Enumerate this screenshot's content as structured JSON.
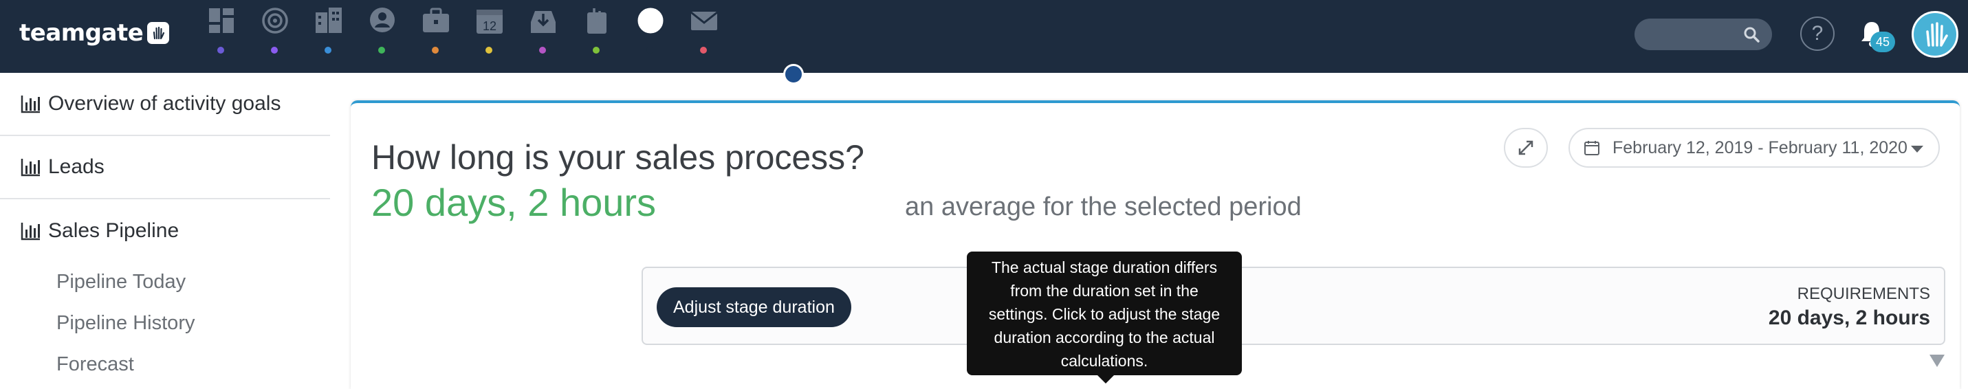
{
  "app": {
    "logo_text": "teamgate"
  },
  "nav": {
    "items": [
      {
        "icon": "dashboard-icon",
        "dot_color": "#6b5bd6"
      },
      {
        "icon": "target-icon",
        "dot_color": "#8b5cf0"
      },
      {
        "icon": "companies-icon",
        "dot_color": "#3a8fd9"
      },
      {
        "icon": "contacts-icon",
        "dot_color": "#3fb55a"
      },
      {
        "icon": "deals-briefcase-icon",
        "dot_color": "#e08a3c"
      },
      {
        "icon": "calendar-icon",
        "dot_color": "#e0c23c"
      },
      {
        "icon": "inbox-download-icon",
        "dot_color": "#b455c4"
      },
      {
        "icon": "attachment-icon",
        "dot_color": "#7fc23a"
      },
      {
        "icon": "reports-pie-icon",
        "dot_color": "#1d2c3f"
      },
      {
        "icon": "mail-icon",
        "dot_color": "#e3596a"
      }
    ],
    "calendar_day": "12"
  },
  "header": {
    "search_placeholder": "",
    "help_label": "?",
    "notification_count": "45"
  },
  "sidebar": {
    "items": [
      {
        "label": "Overview of activity goals"
      },
      {
        "label": "Leads"
      },
      {
        "label": "Sales Pipeline"
      }
    ],
    "subitems": [
      {
        "label": "Pipeline Today"
      },
      {
        "label": "Pipeline History"
      },
      {
        "label": "Forecast"
      }
    ]
  },
  "main": {
    "title": "How long is your sales process?",
    "value": "20 days, 2 hours",
    "value_note": "an average for the selected period",
    "date_range": "February 12, 2019 - February 11, 2020",
    "adjust_button": "Adjust stage duration",
    "requirements_label": "REQUIREMENTS",
    "requirements_value": "20 days, 2 hours",
    "tooltip": "The actual stage duration differs from the duration set in the settings. Click to adjust the stage duration according to the actual calculations."
  }
}
